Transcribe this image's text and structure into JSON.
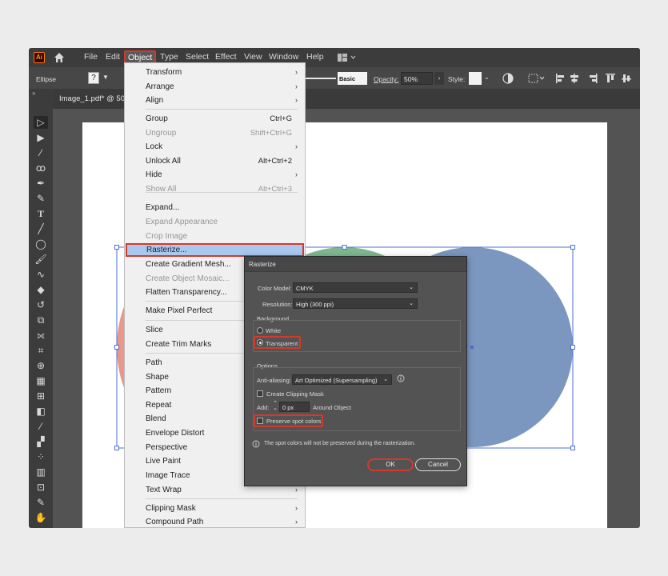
{
  "menubar": {
    "logo": "Ai",
    "items": [
      "File",
      "Edit",
      "Object",
      "Type",
      "Select",
      "Effect",
      "View",
      "Window",
      "Help"
    ],
    "active": "Object"
  },
  "control_bar": {
    "selection": "Ellipse",
    "help": "?",
    "stroke_style": "Basic",
    "opacity_label": "Opacity:",
    "opacity_value": "50%",
    "style_label": "Style:"
  },
  "document_tab": "Image_1.pdf* @ 50",
  "object_menu": {
    "items": [
      {
        "label": "Transform",
        "submenu": true
      },
      {
        "label": "Arrange",
        "submenu": true
      },
      {
        "label": "Align",
        "submenu": true
      },
      {
        "label": "Group",
        "shortcut": "Ctrl+G"
      },
      {
        "label": "Ungroup",
        "shortcut": "Shift+Ctrl+G",
        "disabled": true
      },
      {
        "label": "Lock",
        "submenu": true
      },
      {
        "label": "Unlock All",
        "shortcut": "Alt+Ctrl+2"
      },
      {
        "label": "Hide",
        "submenu": true
      },
      {
        "label": "Show All",
        "shortcut": "Alt+Ctrl+3",
        "disabled": true
      },
      {
        "label": "Expand..."
      },
      {
        "label": "Expand Appearance",
        "disabled": true
      },
      {
        "label": "Crop Image",
        "disabled": true
      },
      {
        "label": "Rasterize...",
        "highlighted": true
      },
      {
        "label": "Create Gradient Mesh..."
      },
      {
        "label": "Create Object Mosaic...",
        "disabled": true
      },
      {
        "label": "Flatten Transparency..."
      },
      {
        "label": "Make Pixel Perfect"
      },
      {
        "label": "Slice",
        "submenu": true
      },
      {
        "label": "Create Trim Marks"
      },
      {
        "label": "Path",
        "submenu": true
      },
      {
        "label": "Shape",
        "submenu": true
      },
      {
        "label": "Pattern",
        "submenu": true
      },
      {
        "label": "Repeat",
        "submenu": true
      },
      {
        "label": "Blend",
        "submenu": true
      },
      {
        "label": "Envelope Distort",
        "submenu": true
      },
      {
        "label": "Perspective",
        "submenu": true
      },
      {
        "label": "Live Paint",
        "submenu": true
      },
      {
        "label": "Image Trace",
        "submenu": true
      },
      {
        "label": "Text Wrap",
        "submenu": true
      },
      {
        "label": "Clipping Mask",
        "submenu": true
      },
      {
        "label": "Compound Path",
        "submenu": true
      }
    ]
  },
  "rasterize_dialog": {
    "title": "Rasterize",
    "color_model_label": "Color Model:",
    "color_model": "CMYK",
    "resolution_label": "Resolution:",
    "resolution": "High (300 ppi)",
    "background_label": "Background",
    "white_label": "White",
    "transparent_label": "Transparent",
    "background_selected": "Transparent",
    "options_label": "Options",
    "antialiasing_label": "Anti-aliasing:",
    "antialiasing": "Art Optimized (Supersampling)",
    "clipping_mask_label": "Create Clipping Mask",
    "add_label": "Add:",
    "add_value": "0 px",
    "around_label": "Around Object",
    "preserve_spot_label": "Preserve spot colors",
    "info_text": "The spot colors will not be preserved during the rasterization.",
    "ok_label": "OK",
    "cancel_label": "Cancel"
  },
  "colors": {
    "highlight_red": "#d33a2c",
    "menu_highlight": "#a9c8ef",
    "ellipse_blue": "#7b97c0",
    "ellipse_green": "#7fb890",
    "ellipse_red": "#e8978a",
    "selection_blue": "#4e6fd8"
  }
}
